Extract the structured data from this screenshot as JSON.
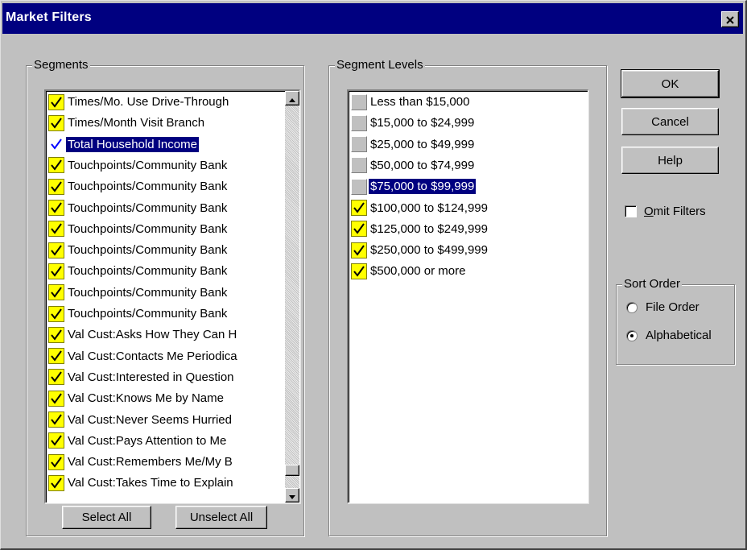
{
  "window": {
    "title": "Market Filters",
    "close_glyph": "✕"
  },
  "segments": {
    "label": "Segments",
    "items": [
      {
        "label": "Times/Mo. Use Drive-Through",
        "checked": true,
        "selected": false
      },
      {
        "label": "Times/Month Visit Branch",
        "checked": true,
        "selected": false
      },
      {
        "label": "Total Household Income",
        "checked": true,
        "selected": true
      },
      {
        "label": "Touchpoints/Community Bank",
        "checked": true,
        "selected": false
      },
      {
        "label": "Touchpoints/Community Bank",
        "checked": true,
        "selected": false
      },
      {
        "label": "Touchpoints/Community Bank",
        "checked": true,
        "selected": false
      },
      {
        "label": "Touchpoints/Community Bank",
        "checked": true,
        "selected": false
      },
      {
        "label": "Touchpoints/Community Bank",
        "checked": true,
        "selected": false
      },
      {
        "label": "Touchpoints/Community Bank",
        "checked": true,
        "selected": false
      },
      {
        "label": "Touchpoints/Community Bank",
        "checked": true,
        "selected": false
      },
      {
        "label": "Touchpoints/Community Bank",
        "checked": true,
        "selected": false
      },
      {
        "label": "Val Cust:Asks How They Can H",
        "checked": true,
        "selected": false
      },
      {
        "label": "Val Cust:Contacts Me Periodica",
        "checked": true,
        "selected": false
      },
      {
        "label": "Val Cust:Interested in Question",
        "checked": true,
        "selected": false
      },
      {
        "label": "Val Cust:Knows Me by Name",
        "checked": true,
        "selected": false
      },
      {
        "label": "Val Cust:Never Seems Hurried",
        "checked": true,
        "selected": false
      },
      {
        "label": "Val Cust:Pays Attention to Me",
        "checked": true,
        "selected": false
      },
      {
        "label": "Val Cust:Remembers Me/My B",
        "checked": true,
        "selected": false
      },
      {
        "label": "Val Cust:Takes Time to Explain",
        "checked": true,
        "selected": false
      }
    ],
    "scroll_position": 0.97,
    "select_all_label": "Select All",
    "unselect_all_label": "Unselect All"
  },
  "segment_levels": {
    "label": "Segment Levels",
    "items": [
      {
        "label": "Less than $15,000",
        "checked": false,
        "selected": false
      },
      {
        "label": "$15,000 to $24,999",
        "checked": false,
        "selected": false
      },
      {
        "label": "$25,000 to $49,999",
        "checked": false,
        "selected": false
      },
      {
        "label": "$50,000 to $74,999",
        "checked": false,
        "selected": false
      },
      {
        "label": "$75,000 to $99,999",
        "checked": false,
        "selected": true
      },
      {
        "label": "$100,000 to $124,999",
        "checked": true,
        "selected": false
      },
      {
        "label": "$125,000 to $249,999",
        "checked": true,
        "selected": false
      },
      {
        "label": "$250,000 to $499,999",
        "checked": true,
        "selected": false
      },
      {
        "label": "$500,000 or more",
        "checked": true,
        "selected": false
      }
    ]
  },
  "buttons": {
    "ok": "OK",
    "cancel": "Cancel",
    "help": "Help"
  },
  "omit_filters": {
    "label_first": "O",
    "label_rest": "mit Filters",
    "checked": false
  },
  "sort_order": {
    "label": "Sort Order",
    "options": [
      {
        "label": "File Order",
        "selected": false
      },
      {
        "label": "Alphabetical",
        "selected": true
      }
    ]
  },
  "colors": {
    "titlebar": "#000080",
    "face": "#c0c0c0",
    "selection": "#000080",
    "check_fill": "#ffff00",
    "check_mark_on": "#000000",
    "check_mark_selected": "#0000ff"
  }
}
